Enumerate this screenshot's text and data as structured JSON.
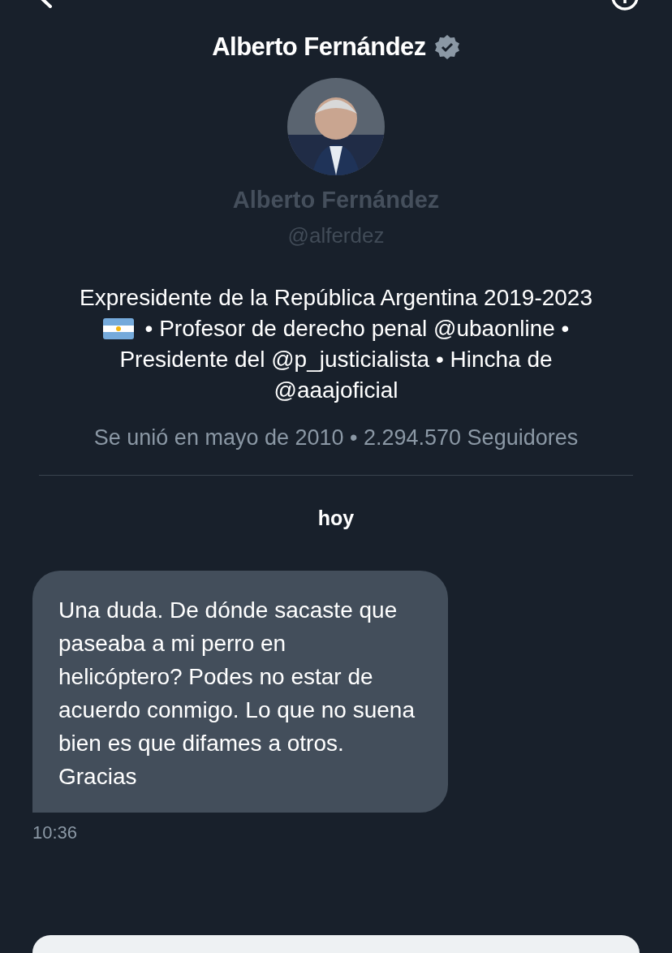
{
  "header": {
    "title": "Alberto Fernández",
    "verified": true
  },
  "profile": {
    "name": "Alberto Fernández",
    "handle": "@alferdez",
    "bio_lines": [
      "Expresidente de la República Argentina 2019-2023",
      "• Profesor de derecho penal @ubaonline •",
      "Presidente del @p_justicialista • Hincha de",
      "@aaajoficial"
    ],
    "meta": "Se unió en mayo de 2010 • 2.294.570 Seguidores"
  },
  "day_separator": "hoy",
  "messages": [
    {
      "kind": "received",
      "text": "Una duda. De dónde sacaste que paseaba a mi perro en helicóptero? Podes no estar de acuerdo conmigo. Lo que no suena bien es que difames a otros. Gracias",
      "time": "10:36"
    }
  ]
}
